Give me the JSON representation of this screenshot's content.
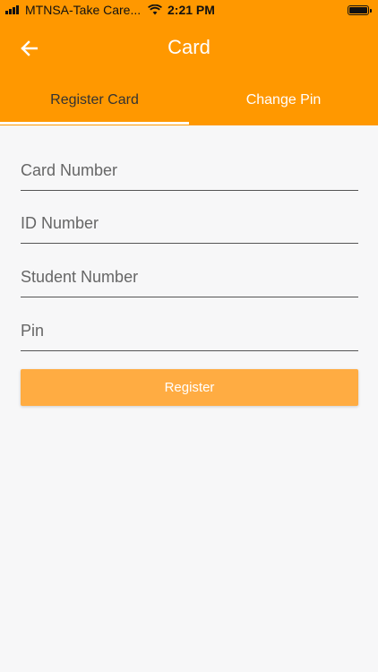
{
  "status_bar": {
    "carrier": "MTNSA-Take Care...",
    "time": "2:21 PM",
    "signal_icon": "signal-icon",
    "wifi_icon": "wifi-icon",
    "battery_icon": "battery-icon"
  },
  "header": {
    "back_icon": "arrow-left-icon",
    "title": "Card",
    "background": "#ff9800"
  },
  "tabs": [
    {
      "label": "Register Card",
      "selected": true
    },
    {
      "label": "Change Pin",
      "selected": false
    }
  ],
  "form": {
    "card_number_placeholder": "Card Number",
    "id_number_placeholder": "ID Number",
    "student_number_placeholder": "Student Number",
    "pin_placeholder": "Pin",
    "register_label": "Register",
    "register_color": "#ffac42"
  }
}
